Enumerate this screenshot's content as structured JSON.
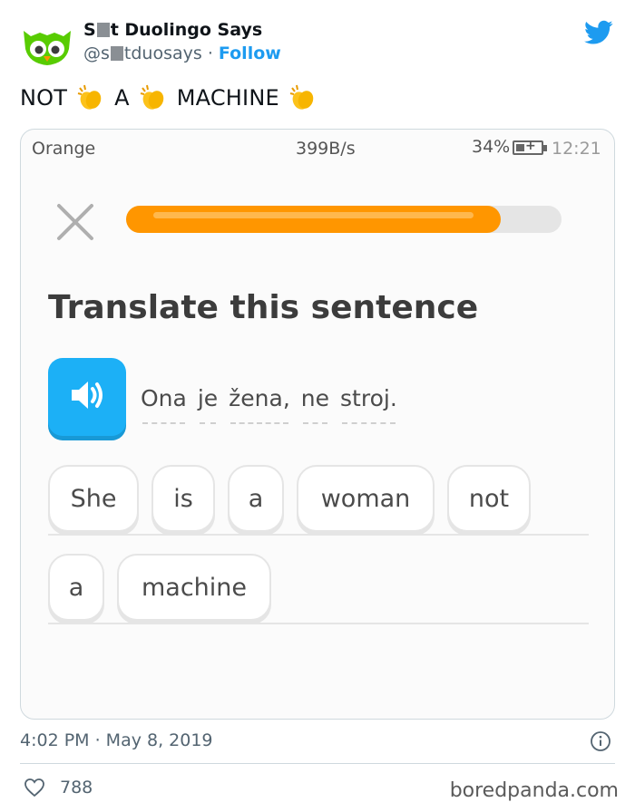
{
  "tweet": {
    "author_name_prefix": "S",
    "author_name_suffix": "t Duolingo Says",
    "handle_prefix": "@s",
    "handle_suffix": "tduosays",
    "separator": "·",
    "follow_label": "Follow",
    "text_parts": [
      "NOT",
      "A",
      "MACHINE"
    ],
    "timestamp": "4:02 PM · May 8, 2019",
    "likes": "788",
    "watermark": "boredpanda.com"
  },
  "phone": {
    "carrier": "Orange",
    "net_speed": "399B/s",
    "battery": "34%",
    "time": "12:21",
    "progress": 0.86
  },
  "lesson": {
    "prompt": "Translate this sentence",
    "sentence_words": [
      "Ona",
      "je",
      "žena,",
      "ne",
      "stroj."
    ],
    "answer_row1": [
      "She",
      "is",
      "a",
      "woman",
      "not"
    ],
    "answer_row2": [
      "a",
      "machine"
    ]
  },
  "colors": {
    "follow": "#1d9bf0",
    "progress": "#ff9600",
    "speaker": "#1cb0f6",
    "owl": "#58cc02"
  },
  "icons": [
    "duolingo-owl-avatar",
    "twitter-bird-icon",
    "clapping-hands-emoji",
    "close-icon",
    "speaker-icon",
    "info-icon",
    "heart-icon"
  ]
}
